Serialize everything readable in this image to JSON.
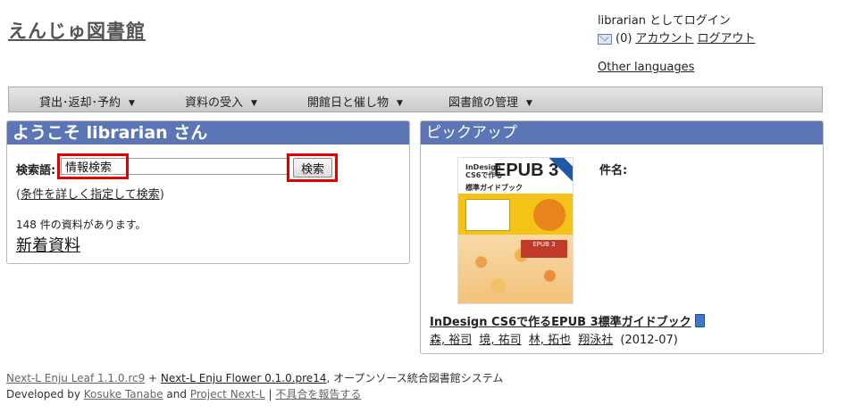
{
  "site": {
    "title": "えんじゅ図書館"
  },
  "user": {
    "login_text": "librarian としてログイン",
    "message_count": "(0)",
    "account_link": "アカウント",
    "logout_link": "ログアウト",
    "other_languages": "Other languages"
  },
  "menu": {
    "items": [
      {
        "label": "貸出･返却･予約",
        "arrow": "▼"
      },
      {
        "label": "資料の受入",
        "arrow": "▼"
      },
      {
        "label": "開館日と催し物",
        "arrow": "▼"
      },
      {
        "label": "図書館の管理",
        "arrow": "▼"
      }
    ]
  },
  "welcome": {
    "title": "ようこそ librarian さん",
    "search_label": "検索語:",
    "search_value": "情報検索",
    "search_button": "検索",
    "advanced_open": "(",
    "advanced_link": "条件を詳しく指定して検索",
    "advanced_close": ")",
    "count_text": "148 件の資料があります。",
    "new_items_link": "新着資料"
  },
  "pickup": {
    "title": "ピックアップ",
    "field_label": "件名:",
    "cover": {
      "line1": "InDesign",
      "line2": "CS6で作る",
      "main": "EPUB 3",
      "sub": "標準ガイドブック",
      "band": "EPUB 3"
    },
    "book_title": "InDesign CS6で作るEPUB 3標準ガイドブック",
    "authors": [
      "森, 裕司",
      "境, 祐司",
      "林, 拓也",
      "翔泳社"
    ],
    "date": "(2012-07)"
  },
  "footer": {
    "leaf_link": "Next-L Enju Leaf 1.1.0.rc9",
    "plus": " + ",
    "flower_link": "Next-L Enju Flower 0.1.0.pre14",
    "suffix": ", オープンソース統合図書館システム",
    "developed_by": "Developed by ",
    "dev_name": "Kosuke Tanabe",
    "and_text": " and ",
    "project_link": "Project Next-L",
    "sep": " | ",
    "report_link": "不具合を報告する"
  }
}
